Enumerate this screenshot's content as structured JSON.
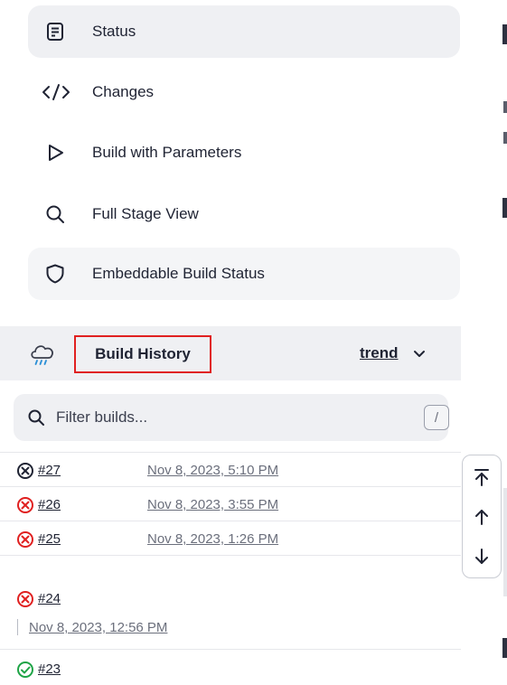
{
  "sidebar": {
    "items": [
      {
        "label": "Status",
        "icon": "document-icon"
      },
      {
        "label": "Changes",
        "icon": "code-icon"
      },
      {
        "label": "Build with Parameters",
        "icon": "play-icon"
      },
      {
        "label": "Full Stage View",
        "icon": "search-icon"
      },
      {
        "label": "Embeddable Build Status",
        "icon": "shield-icon"
      }
    ]
  },
  "build_history": {
    "title": "Build History",
    "trend_label": "trend",
    "filter_placeholder": "Filter builds...",
    "shortcut_key": "/",
    "builds": [
      {
        "number": "#27",
        "date": "Nov 8, 2023, 5:10 PM",
        "status": "aborted"
      },
      {
        "number": "#26",
        "date": "Nov 8, 2023, 3:55 PM",
        "status": "failed"
      },
      {
        "number": "#25",
        "date": "Nov 8, 2023, 1:26 PM",
        "status": "failed"
      },
      {
        "number": "#24",
        "date": "Nov 8, 2023, 12:56 PM",
        "status": "failed"
      },
      {
        "number": "#23",
        "date": "",
        "status": "success"
      }
    ]
  },
  "colors": {
    "failed": "#e02020",
    "success": "#1ea446",
    "aborted": "#1f2333",
    "highlight_border": "#e02020",
    "panel_bg": "#eff0f3"
  }
}
